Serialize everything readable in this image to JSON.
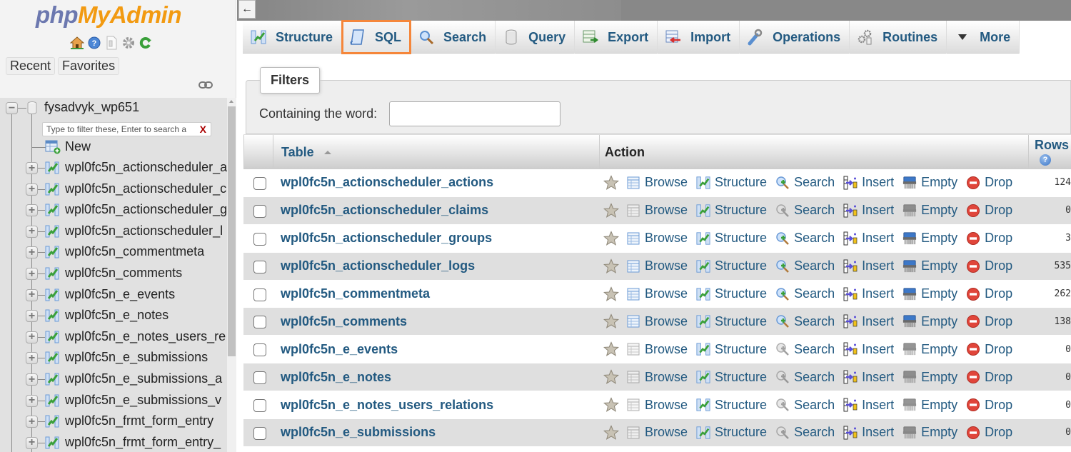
{
  "sidebar": {
    "logo": {
      "part1": "php",
      "part2": "MyAdmin"
    },
    "quick_icons": [
      "home-icon",
      "help-icon",
      "docs-icon",
      "settings-icon",
      "reload-icon"
    ],
    "recent_label": "Recent",
    "favorites_label": "Favorites",
    "database": "fysadvyk_wp651",
    "filter_placeholder": "Type to filter these, Enter to search a",
    "filter_clear": "X",
    "new_label": "New",
    "tables": [
      "wpl0fc5n_actionscheduler_a",
      "wpl0fc5n_actionscheduler_c",
      "wpl0fc5n_actionscheduler_g",
      "wpl0fc5n_actionscheduler_l",
      "wpl0fc5n_commentmeta",
      "wpl0fc5n_comments",
      "wpl0fc5n_e_events",
      "wpl0fc5n_e_notes",
      "wpl0fc5n_e_notes_users_re",
      "wpl0fc5n_e_submissions",
      "wpl0fc5n_e_submissions_a",
      "wpl0fc5n_e_submissions_v",
      "wpl0fc5n_frmt_form_entry",
      "wpl0fc5n_frmt_form_entry_"
    ]
  },
  "topbar": {
    "back_label": "←"
  },
  "menu": [
    {
      "label": "Structure",
      "icon": "structure-icon"
    },
    {
      "label": "SQL",
      "icon": "sql-icon",
      "highlighted": true
    },
    {
      "label": "Search",
      "icon": "search-icon"
    },
    {
      "label": "Query",
      "icon": "query-icon"
    },
    {
      "label": "Export",
      "icon": "export-icon"
    },
    {
      "label": "Import",
      "icon": "import-icon"
    },
    {
      "label": "Operations",
      "icon": "wrench-icon"
    },
    {
      "label": "Routines",
      "icon": "routines-icon"
    },
    {
      "label": "More",
      "icon": "caret-down-icon"
    }
  ],
  "filters": {
    "legend": "Filters",
    "label": "Containing the word:",
    "value": ""
  },
  "table": {
    "headers": {
      "table": "Table",
      "action": "Action",
      "rows": "Rows"
    },
    "actions": [
      "Browse",
      "Structure",
      "Search",
      "Insert",
      "Empty",
      "Drop"
    ],
    "rows": [
      {
        "name": "wpl0fc5n_actionscheduler_actions",
        "rows": "124",
        "empty": false
      },
      {
        "name": "wpl0fc5n_actionscheduler_claims",
        "rows": "0",
        "empty": true
      },
      {
        "name": "wpl0fc5n_actionscheduler_groups",
        "rows": "3",
        "empty": false
      },
      {
        "name": "wpl0fc5n_actionscheduler_logs",
        "rows": "535",
        "empty": false
      },
      {
        "name": "wpl0fc5n_commentmeta",
        "rows": "262",
        "empty": false
      },
      {
        "name": "wpl0fc5n_comments",
        "rows": "138",
        "empty": false
      },
      {
        "name": "wpl0fc5n_e_events",
        "rows": "0",
        "empty": true
      },
      {
        "name": "wpl0fc5n_e_notes",
        "rows": "0",
        "empty": true
      },
      {
        "name": "wpl0fc5n_e_notes_users_relations",
        "rows": "0",
        "empty": true
      },
      {
        "name": "wpl0fc5n_e_submissions",
        "rows": "0",
        "empty": true
      }
    ]
  },
  "colors": {
    "link": "#235a81",
    "highlight": "#f5863a",
    "logo_php": "#6c78af",
    "logo_myadmin": "#f29a11"
  }
}
